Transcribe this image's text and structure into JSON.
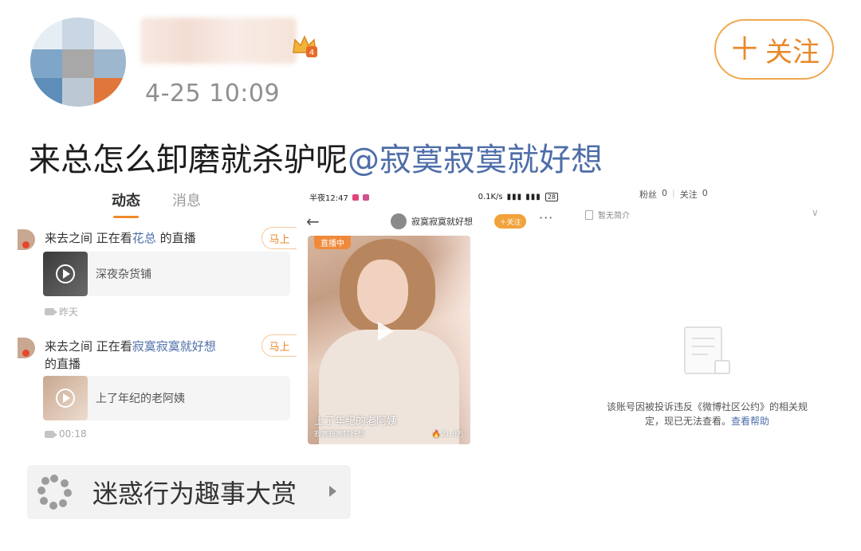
{
  "post": {
    "timestamp": "4-25 10:09",
    "follow_label": "关注",
    "follow_plus": "＋",
    "text": "来总怎么卸磨就杀驴呢",
    "mention": "@寂寞寂寞就好想"
  },
  "left_panel": {
    "tabs": [
      "动态",
      "消息"
    ],
    "feed": [
      {
        "user": "来去之间",
        "action": " 正在看",
        "liver": "花总",
        "suffix": " 的直播",
        "suffix2": "",
        "button": "马上",
        "card_title": "深夜杂货铺",
        "meta": "昨天"
      },
      {
        "user": "来去之间",
        "action": " 正在看",
        "liver": "寂寞寂寞就好想",
        "suffix": "",
        "suffix2": "的直播",
        "button": "马上",
        "card_title": "上了年纪的老阿姨",
        "meta": "00:18"
      }
    ]
  },
  "phone": {
    "status_time": "半夜12:47",
    "status_right": "0.1K/s",
    "battery": "28",
    "nav_user": "寂寞寂寞就好想",
    "nav_follow": "＋关注",
    "nav_more": "···",
    "live_badge": "直播中",
    "tile_title": "上了年纪的老阿姨",
    "tile_user": "寂寞寂寞就好想",
    "tile_heat": "21.8万"
  },
  "right_panel": {
    "fans_label": "粉丝",
    "fans": "0",
    "follows_label": "关注",
    "follows": "0",
    "intro": "暂无简介",
    "notice": "该账号因被投诉违反《微博社区公约》的相关规定，现已无法查看。",
    "help": "查看帮助"
  },
  "topic": {
    "label": "迷惑行为趣事大赏"
  },
  "colors": {
    "accent_orange": "#e8882a",
    "link_blue": "#4e6ea8",
    "muted_gray": "#8f8f8f"
  }
}
